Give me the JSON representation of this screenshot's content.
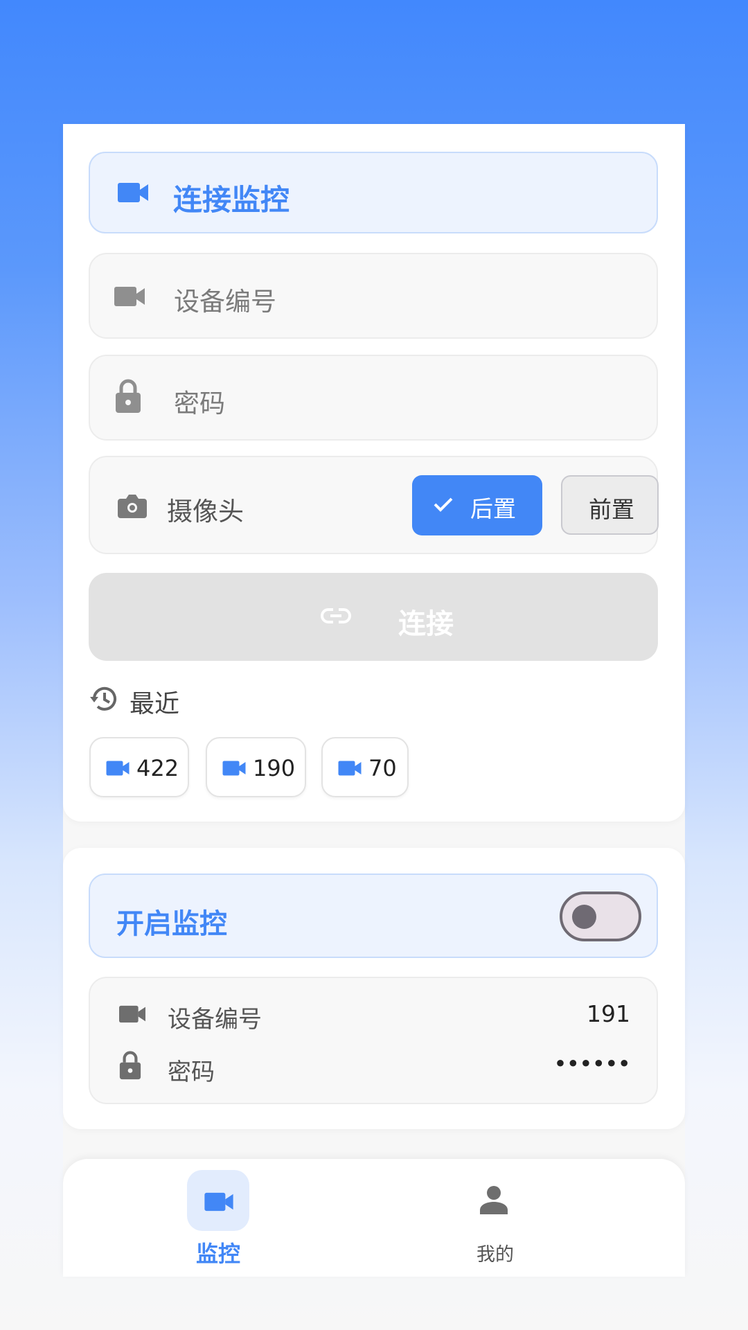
{
  "colors": {
    "accent": "#4287f6",
    "header_bg": "#edf3fe",
    "muted": "#8a8a8a",
    "disabled": "#e2e2e2"
  },
  "connect_card": {
    "title": "连接监控",
    "title_icon": "videocam-icon",
    "device_input": {
      "placeholder": "设备编号",
      "value": "",
      "icon": "videocam-icon"
    },
    "password_input": {
      "placeholder": "密码",
      "value": "",
      "icon": "lock-icon"
    },
    "camera": {
      "label": "摄像头",
      "icon": "camera-icon",
      "options": [
        {
          "label": "后置",
          "selected": true
        },
        {
          "label": "前置",
          "selected": false
        }
      ]
    },
    "connect_button": {
      "label": "连接",
      "icon": "link-icon",
      "enabled": false
    },
    "recent": {
      "label": "最近",
      "icon": "history-icon",
      "items": [
        "422",
        "190",
        "70"
      ]
    }
  },
  "monitor_card": {
    "title": "开启监控",
    "toggle_on": false,
    "rows": [
      {
        "label": "设备编号",
        "value": "191",
        "icon": "videocam-icon"
      },
      {
        "label": "密码",
        "value": "••••••",
        "icon": "lock-icon"
      }
    ]
  },
  "bottom_nav": {
    "items": [
      {
        "label": "监控",
        "icon": "videocam-icon",
        "active": true
      },
      {
        "label": "我的",
        "icon": "person-icon",
        "active": false
      }
    ]
  }
}
